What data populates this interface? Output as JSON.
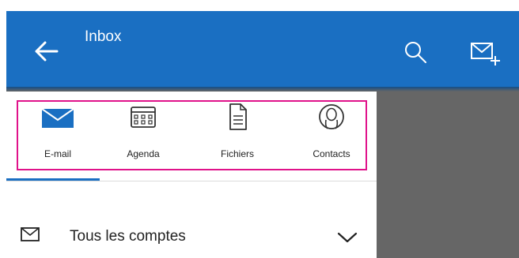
{
  "header": {
    "title": "Inbox",
    "background": "#1a6fc2",
    "back_icon": "arrow-left-icon",
    "search_icon": "search-icon",
    "compose_icon": "new-mail-icon"
  },
  "apps": {
    "highlight_color": "#e0128a",
    "items": [
      {
        "label": "E-mail",
        "icon": "envelope-icon",
        "selected": true
      },
      {
        "label": "Agenda",
        "icon": "calendar-icon",
        "selected": false
      },
      {
        "label": "Fichiers",
        "icon": "file-icon",
        "selected": false
      },
      {
        "label": "Contacts",
        "icon": "person-icon",
        "selected": false
      }
    ]
  },
  "accounts": {
    "label": "Tous les comptes",
    "icon": "envelope-outline-icon",
    "toggle_icon": "chevron-down-icon"
  }
}
